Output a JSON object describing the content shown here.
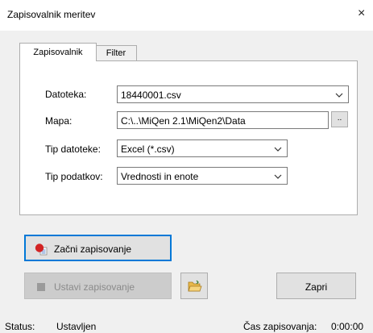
{
  "window": {
    "title": "Zapisovalnik meritev",
    "close_glyph": "×"
  },
  "tabs": [
    {
      "label": "Zapisovalnik",
      "active": true
    },
    {
      "label": "Filter",
      "active": false
    }
  ],
  "form": {
    "file": {
      "label": "Datoteka:",
      "value": "18440001.csv"
    },
    "folder": {
      "label": "Mapa:",
      "value": "C:\\..\\MiQen 2.1\\MiQen2\\Data",
      "browse_label": ".."
    },
    "file_type": {
      "label": "Tip datoteke:",
      "value": "Excel (*.csv)"
    },
    "data_type": {
      "label": "Tip podatkov:",
      "value": "Vrednosti in enote"
    }
  },
  "buttons": {
    "start": {
      "label": "Začni zapisovanje",
      "icon": "record-icon"
    },
    "stop": {
      "label": "Ustavi zapisovanje",
      "icon": "stop-icon"
    },
    "open_folder": {
      "icon": "folder-icon"
    },
    "close": {
      "label": "Zapri"
    }
  },
  "status": {
    "label": "Status:",
    "value": "Ustavljen",
    "duration_label": "Čas zapisovanja:",
    "duration_value": "0:00:00"
  },
  "colors": {
    "focus_border": "#0078d7",
    "record_red": "#d22323",
    "folder_yellow": "#e8b84a"
  }
}
